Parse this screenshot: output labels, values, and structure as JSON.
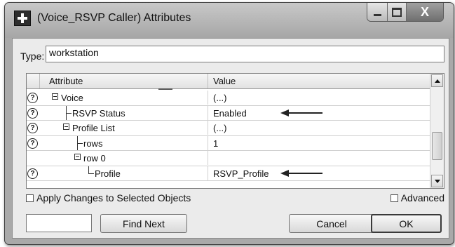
{
  "window": {
    "title": "(Voice_RSVP Caller) Attributes",
    "close_glyph": "X"
  },
  "type_field": {
    "label": "Type:",
    "value": "workstation"
  },
  "grid": {
    "headers": {
      "attribute": "Attribute",
      "value": "Value"
    },
    "rows": [
      {
        "attribute": "Voice",
        "value": "(...)",
        "has_help": true,
        "kind": "expand",
        "indent": 0,
        "highlight_arrow": false
      },
      {
        "attribute": "RSVP Status",
        "value": "Enabled",
        "has_help": true,
        "kind": "tee",
        "indent": 1,
        "highlight_arrow": true
      },
      {
        "attribute": "Profile List",
        "value": "(...)",
        "has_help": true,
        "kind": "expand",
        "indent": 1,
        "highlight_arrow": false
      },
      {
        "attribute": "rows",
        "value": "1",
        "has_help": true,
        "kind": "tee",
        "indent": 2,
        "highlight_arrow": false
      },
      {
        "attribute": "row 0",
        "value": "",
        "has_help": false,
        "kind": "expand",
        "indent": 2,
        "highlight_arrow": false
      },
      {
        "attribute": "Profile",
        "value": "RSVP_Profile",
        "has_help": true,
        "kind": "ell",
        "indent": 3,
        "highlight_arrow": true
      }
    ],
    "help_glyph": "?"
  },
  "options": {
    "apply_label": "Apply Changes to Selected Objects",
    "apply_checked": false,
    "advanced_label": "Advanced",
    "advanced_checked": false
  },
  "buttons": {
    "find_next": "Find Next",
    "cancel": "Cancel",
    "ok": "OK"
  },
  "find_input_value": ""
}
